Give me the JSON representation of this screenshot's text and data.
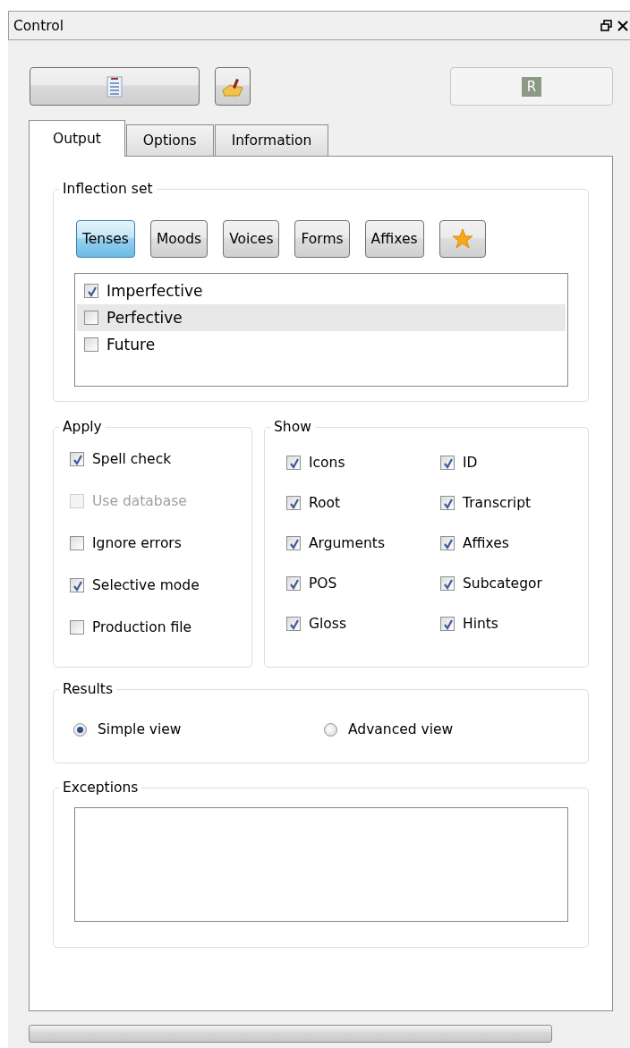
{
  "window": {
    "title": "Control"
  },
  "toolbar": [
    {
      "disabled": false
    },
    {
      "disabled": false
    },
    {
      "label": "R",
      "disabled": true
    }
  ],
  "tabs": [
    {
      "label": "Output",
      "selected": true
    },
    {
      "label": "Options",
      "selected": false
    },
    {
      "label": "Information",
      "selected": false
    }
  ],
  "inflection_set": {
    "title": "Inflection set",
    "categories": [
      {
        "kind": "text",
        "label": "Tenses",
        "selected": true
      },
      {
        "kind": "text",
        "label": "Moods",
        "selected": false
      },
      {
        "kind": "text",
        "label": "Voices",
        "selected": false
      },
      {
        "kind": "text",
        "label": "Forms",
        "selected": false
      },
      {
        "kind": "text",
        "label": "Affixes",
        "selected": false
      },
      {
        "kind": "star",
        "selected": false
      }
    ],
    "items": [
      {
        "label": "Imperfective",
        "checked": true,
        "selected": false
      },
      {
        "label": "Perfective",
        "checked": false,
        "selected": true
      },
      {
        "label": "Future",
        "checked": false,
        "selected": false
      }
    ]
  },
  "apply": {
    "title": "Apply",
    "options": [
      {
        "label": "Spell check",
        "checked": true,
        "disabled": false
      },
      {
        "label": "Use database",
        "checked": false,
        "disabled": true
      },
      {
        "label": "Ignore errors",
        "checked": false,
        "disabled": false
      },
      {
        "label": "Selective mode",
        "checked": true,
        "disabled": false
      },
      {
        "label": "Production file",
        "checked": false,
        "disabled": false
      }
    ]
  },
  "show": {
    "title": "Show",
    "options": [
      {
        "label": "Icons",
        "checked": true
      },
      {
        "label": "ID",
        "checked": true
      },
      {
        "label": "Root",
        "checked": true
      },
      {
        "label": "Transcript",
        "checked": true
      },
      {
        "label": "Arguments",
        "checked": true
      },
      {
        "label": "Affixes",
        "checked": true
      },
      {
        "label": "POS",
        "checked": true
      },
      {
        "label": "Subcategor",
        "checked": true
      },
      {
        "label": "Gloss",
        "checked": true
      },
      {
        "label": "Hints",
        "checked": true
      }
    ]
  },
  "results": {
    "title": "Results",
    "options": [
      {
        "label": "Simple view",
        "selected": true
      },
      {
        "label": "Advanced view",
        "selected": false
      }
    ]
  },
  "exceptions": {
    "title": "Exceptions"
  }
}
